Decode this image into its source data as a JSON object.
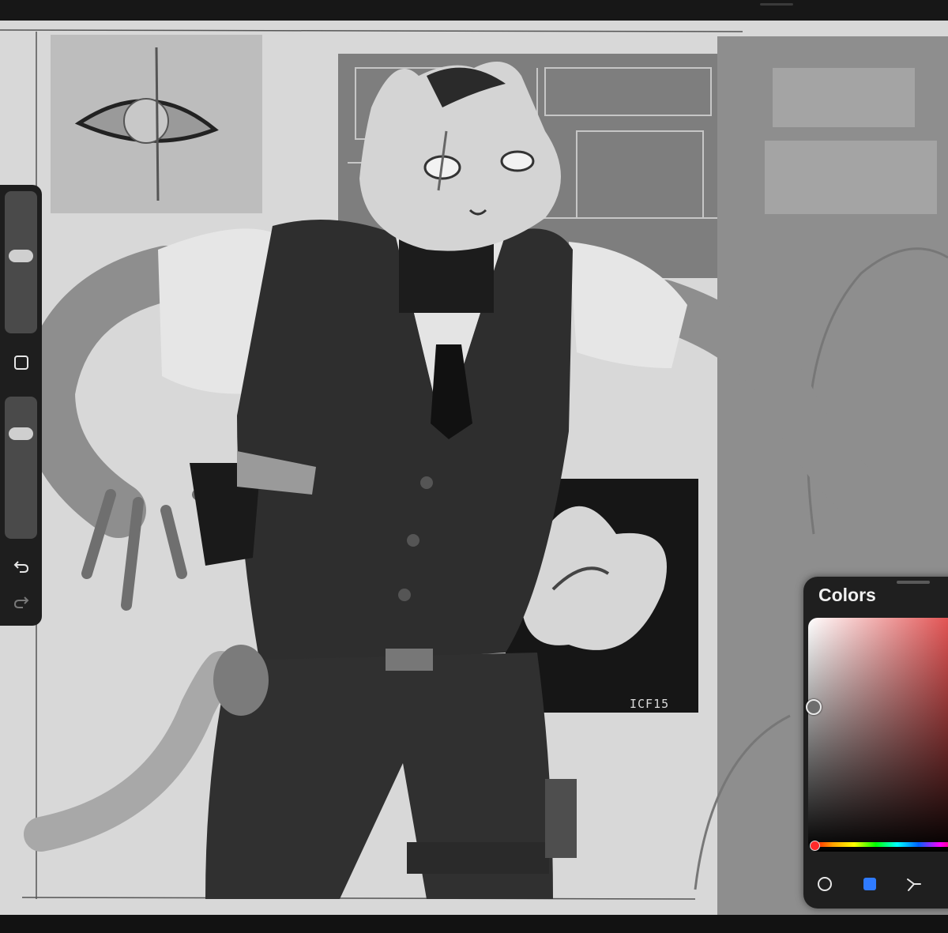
{
  "app": {
    "colors_panel": {
      "title": "Colors"
    },
    "artwork": {
      "signature": "ICF15"
    },
    "tools": {
      "brush_size_slider": {
        "level": 0.55
      },
      "opacity_slider": {
        "level": 0.22
      },
      "modify_icon": "square-icon",
      "undo_icon": "undo-icon",
      "redo_icon": "redo-icon"
    },
    "palette_tools": [
      "disc-icon",
      "classic-square-icon",
      "harmony-icon"
    ],
    "colors": {
      "selected_hue": "#e04444",
      "accent": "#2f7bff",
      "panel_bg": "#1f1f1f"
    }
  }
}
